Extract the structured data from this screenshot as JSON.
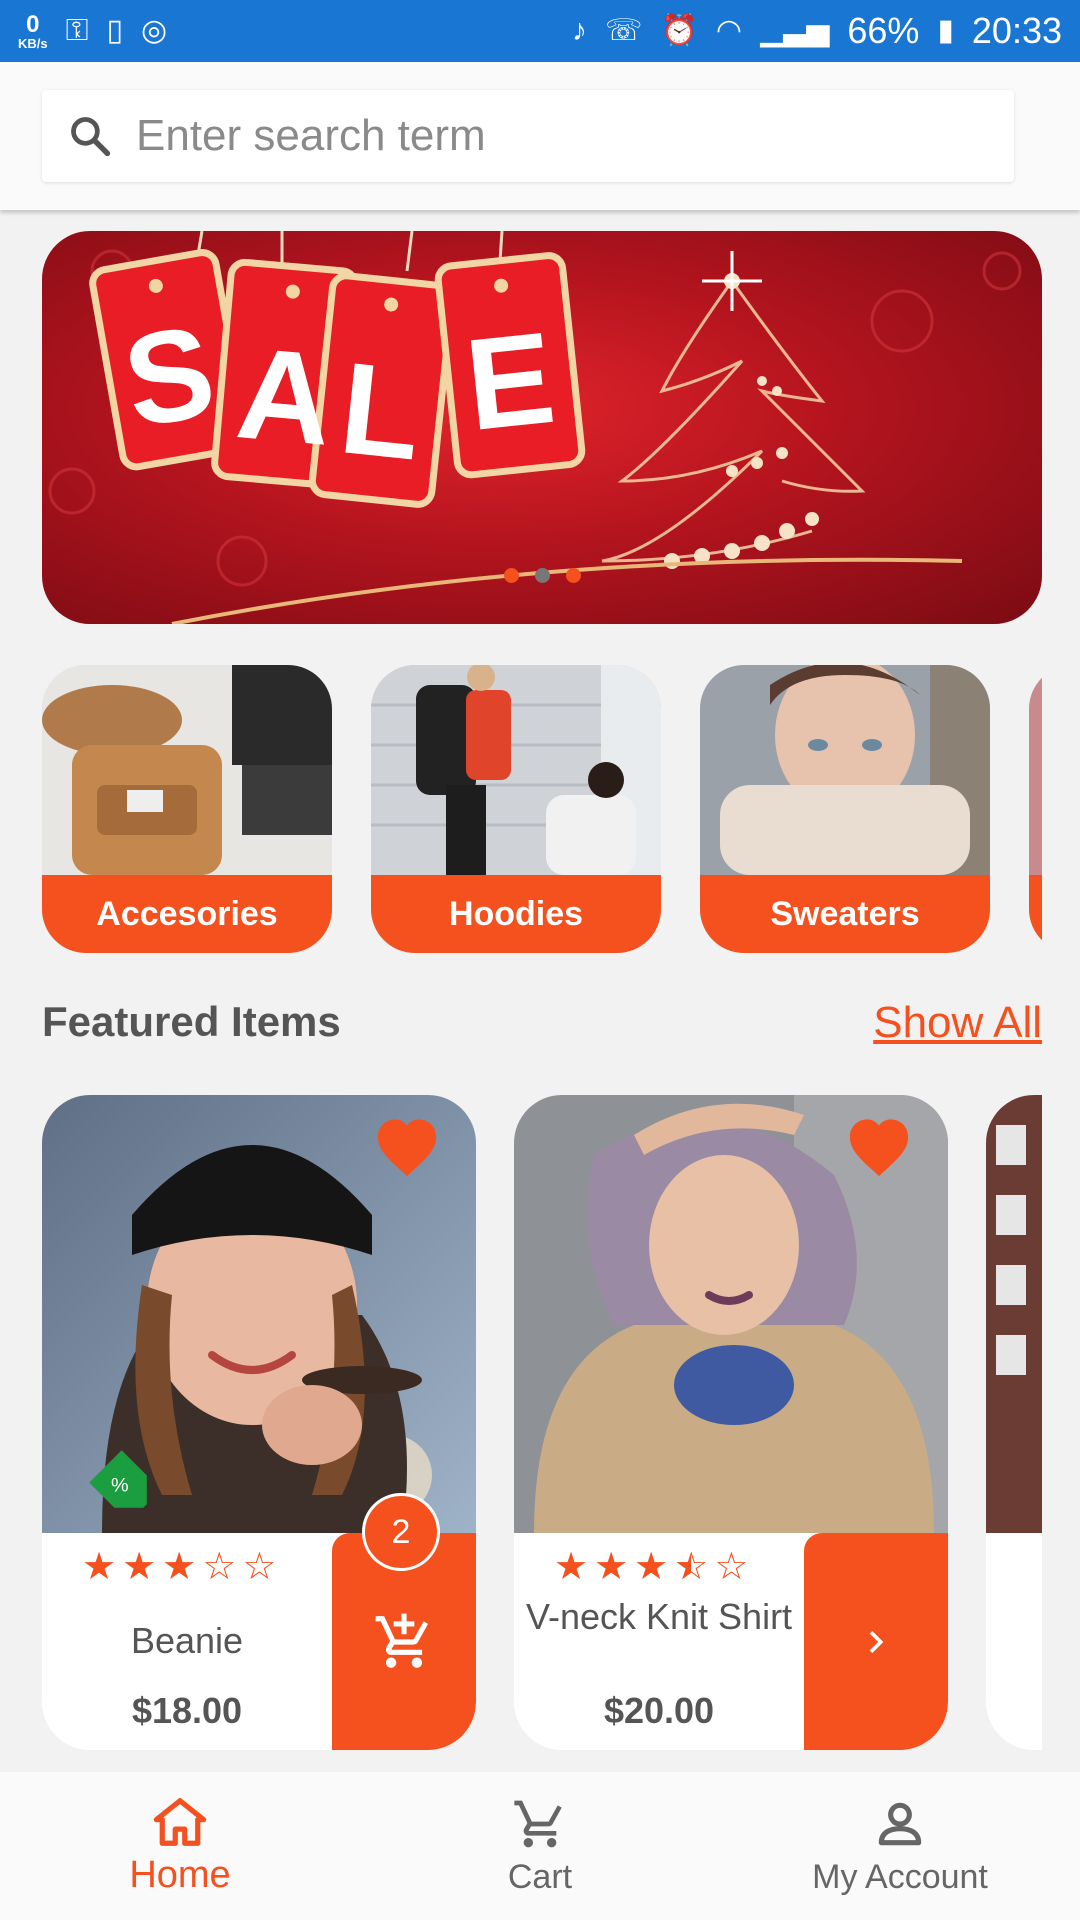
{
  "status_bar": {
    "speed_value": "0",
    "speed_unit": "KB/s",
    "battery": "66%",
    "time": "20:33"
  },
  "search": {
    "placeholder": "Enter search term",
    "value": ""
  },
  "banner": {
    "letters": [
      "S",
      "A",
      "L",
      "E"
    ],
    "page_count": 3,
    "active_index": 1
  },
  "categories": [
    {
      "label": "Accesories"
    },
    {
      "label": "Hoodies"
    },
    {
      "label": "Sweaters"
    }
  ],
  "featured": {
    "title": "Featured Items",
    "show_all": "Show All",
    "items": [
      {
        "name": "Beanie",
        "price": "$18.00",
        "rating": 3,
        "cart_count": "2",
        "discount_tag": "%"
      },
      {
        "name": "V-neck Knit Shirt",
        "price": "$20.00",
        "rating": 3.5
      }
    ]
  },
  "bottom_nav": {
    "items": [
      {
        "label": "Home",
        "icon": "home-icon",
        "active": true
      },
      {
        "label": "Cart",
        "icon": "cart-icon",
        "active": false
      },
      {
        "label": "My Account",
        "icon": "account-icon",
        "active": false
      }
    ]
  },
  "colors": {
    "accent": "#f4511e",
    "status_bar": "#1976d2",
    "tag_green": "#1a9e3f"
  }
}
